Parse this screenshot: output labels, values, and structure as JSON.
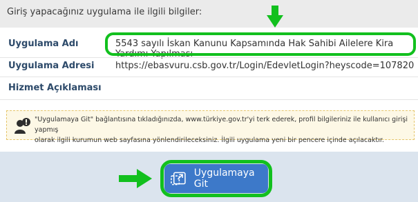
{
  "header": {
    "title": "Giriş yapacağınız uygulama ile ilgili bilgiler:"
  },
  "fields": [
    {
      "label": "Uygulama Adı",
      "value": "5543 sayılı İskan Kanunu Kapsamında Hak Sahibi Ailelere Kira Yardımı Yapılması"
    },
    {
      "label": "Uygulama Adresi",
      "value": "https://ebasvuru.csb.gov.tr/Login/EdevletLogin?heyscode=107820"
    },
    {
      "label": "Hizmet Açıklaması",
      "value": ""
    }
  ],
  "info": {
    "line1": "\"Uygulamaya Git\" bağlantısına tıkladığınızda, www.türkiye.gov.tr'yi terk ederek, profil bilgileriniz ile kullanıcı girişi yapmış",
    "line2": "olarak ilgili kurumun web sayfasına yönlendirileceksiniz. İlgili uygulama yeni bir pencere içinde açılacaktır."
  },
  "action": {
    "go_label": "Uygulamaya Git"
  },
  "colors": {
    "highlight": "#12c01e",
    "button": "#3d79c9",
    "footer": "#dbe4ee"
  },
  "icons": {
    "info": "user-warning-icon",
    "go": "external-app-icon",
    "pointer_down": "arrow-down-icon",
    "pointer_right": "arrow-right-icon"
  }
}
